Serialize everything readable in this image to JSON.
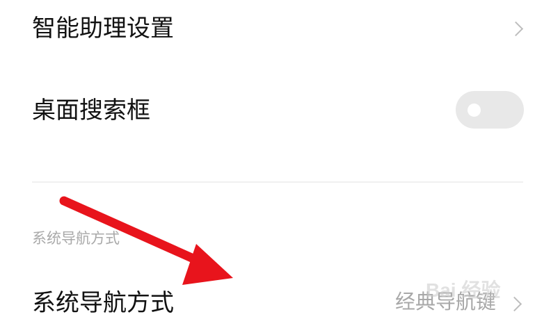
{
  "assistant_settings": {
    "label": "智能助理设置",
    "icon": "chevron-right-icon"
  },
  "desktop_search": {
    "label": "桌面搜索框",
    "toggle_state": "off"
  },
  "navigation_section": {
    "header": "系统导航方式"
  },
  "navigation_mode": {
    "label": "系统导航方式",
    "value": "经典导航键",
    "icon": "chevron-right-icon"
  },
  "annotation": {
    "arrow_color": "#e8141c"
  },
  "watermark": {
    "text": "Bai 经验"
  }
}
